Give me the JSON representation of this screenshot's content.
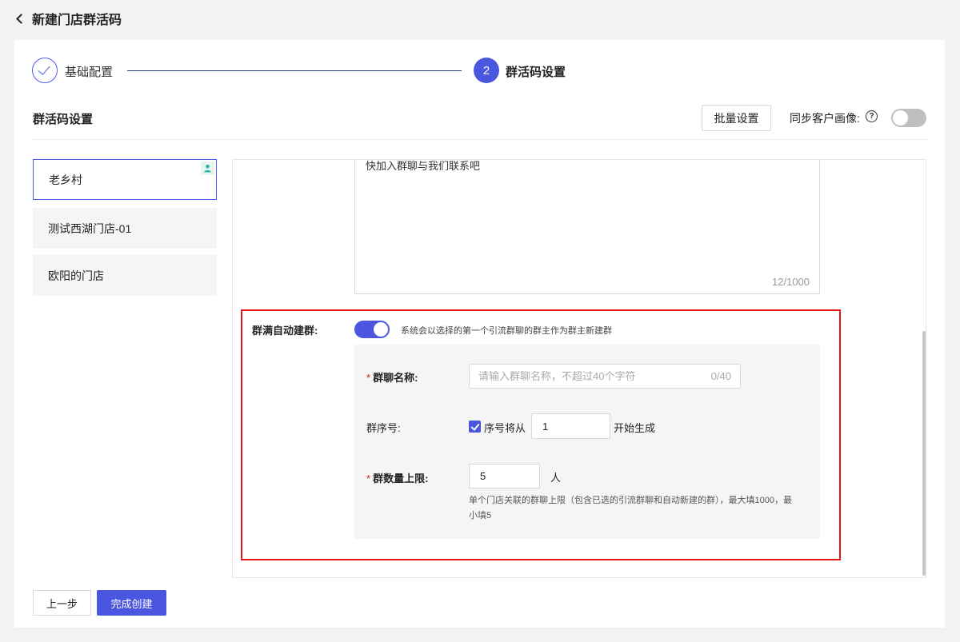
{
  "header": {
    "title": "新建门店群活码"
  },
  "steps": [
    {
      "label": "基础配置",
      "status": "done"
    },
    {
      "number": "2",
      "label": "群活码设置",
      "status": "current"
    }
  ],
  "section": {
    "title": "群活码设置",
    "batch_button": "批量设置",
    "sync_label": "同步客户画像:",
    "help_glyph": "?",
    "sync_enabled": false
  },
  "stores": [
    {
      "name": "老乡村",
      "active": true
    },
    {
      "name": "测试西湖门店-01",
      "active": false
    },
    {
      "name": "欧阳的门店",
      "active": false
    }
  ],
  "welcome": {
    "text_visible": "快加入群聊与我们联系吧",
    "count": "12/1000"
  },
  "auto_group": {
    "label": "群满自动建群:",
    "enabled": true,
    "description": "系统会以选择的第一个引流群聊的群主作为群主新建群",
    "name_label": "群聊名称:",
    "name_placeholder": "请输入群聊名称，不超过40个字符",
    "name_count": "0/40",
    "seq_label": "群序号:",
    "seq_checked": true,
    "seq_text_prefix": "序号将从",
    "seq_value": "1",
    "seq_text_suffix": "开始生成",
    "max_label": "群数量上限:",
    "max_value": "5",
    "max_unit": "人",
    "max_hint": "单个门店关联的群聊上限（包含已选的引流群聊和自动新建的群），最大填1000，最小填5"
  },
  "footer": {
    "prev": "上一步",
    "finish": "完成创建"
  },
  "colors": {
    "primary": "#4a55e0",
    "highlight_border": "#e0141b",
    "required": "#e0141b"
  }
}
